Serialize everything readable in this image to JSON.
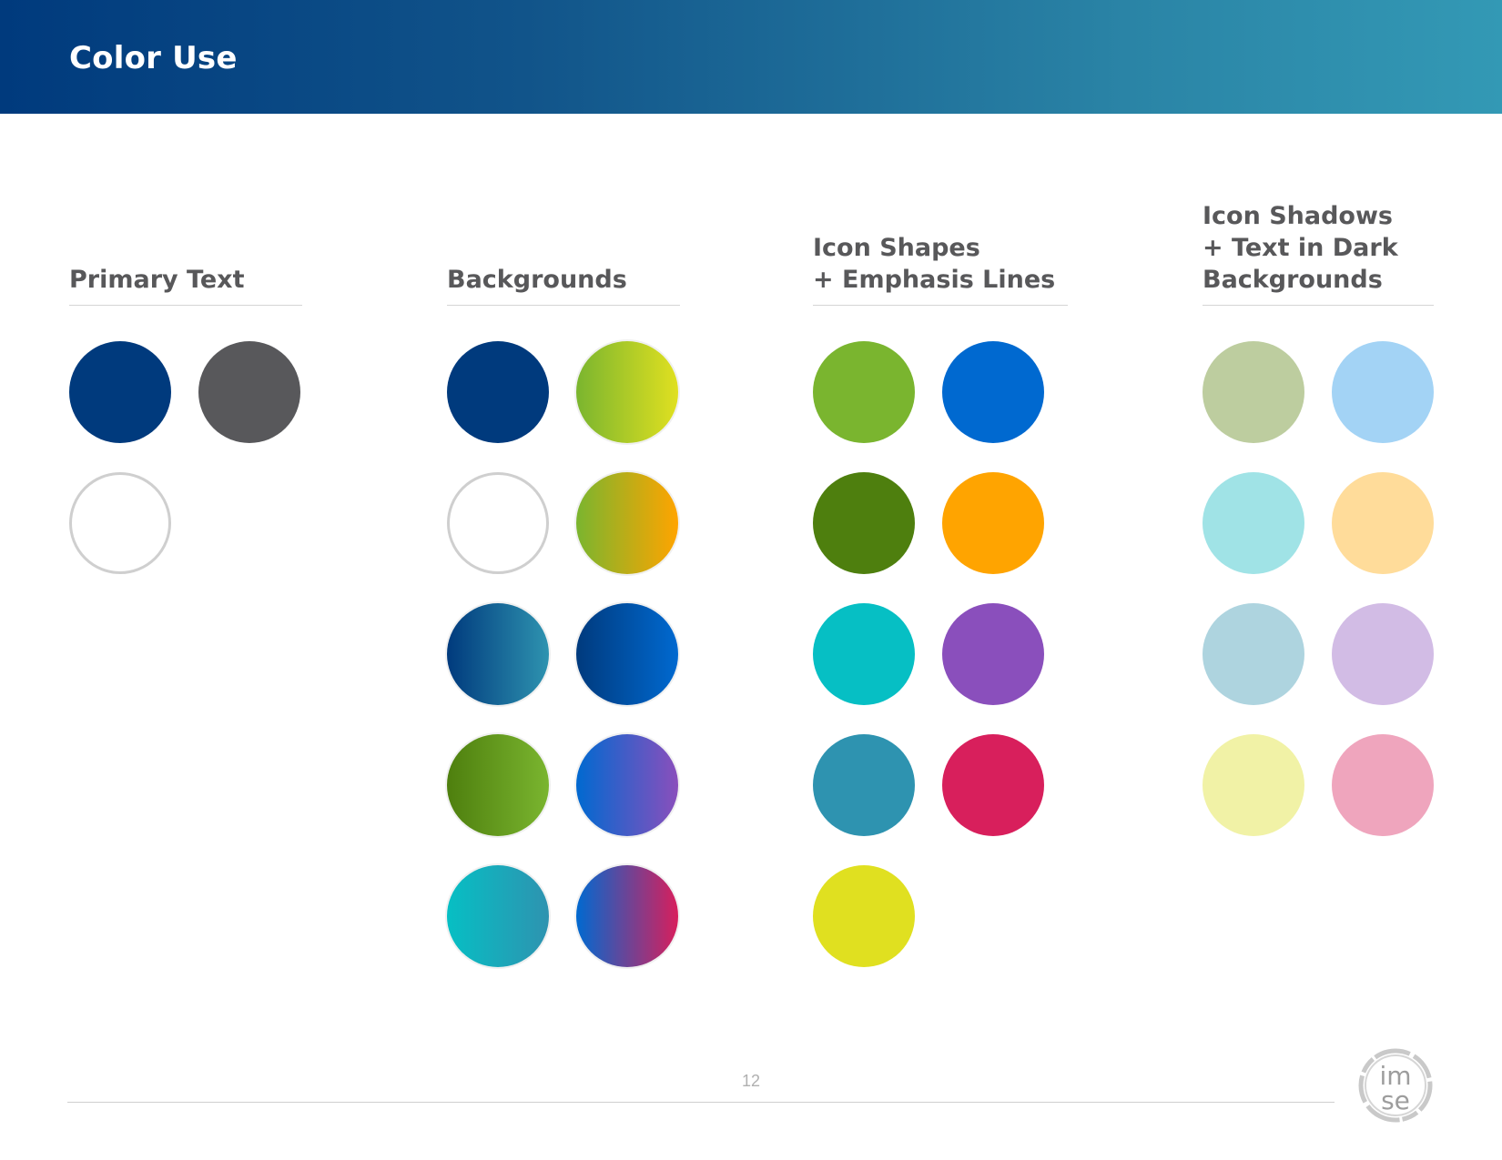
{
  "header": {
    "title": "Color Use"
  },
  "columns": [
    {
      "title": "Primary Text",
      "swatches": [
        {
          "color": "#003a7d",
          "style": "solid"
        },
        {
          "color": "#58585b",
          "style": "solid"
        },
        {
          "color": "#ffffff",
          "style": "outlined"
        }
      ]
    },
    {
      "title": "Backgrounds",
      "swatches": [
        {
          "color": "#003a7d",
          "style": "solid"
        },
        {
          "color": "linear-gradient(90deg, #7ab52f, #e0e020)",
          "style": "gradient"
        },
        {
          "color": "#ffffff",
          "style": "outlined"
        },
        {
          "color": "linear-gradient(90deg, #7ab52f, #ffa400)",
          "style": "gradient"
        },
        {
          "color": "linear-gradient(90deg, #003a7d, #2e93b0)",
          "style": "gradient"
        },
        {
          "color": "linear-gradient(90deg, #003a7d, #0069d0)",
          "style": "gradient"
        },
        {
          "color": "linear-gradient(90deg, #4e7f0e, #7ab52f)",
          "style": "gradient"
        },
        {
          "color": "linear-gradient(90deg, #0069d0, #8a4fbc)",
          "style": "gradient"
        },
        {
          "color": "linear-gradient(90deg, #06bfc4, #2e93b0)",
          "style": "gradient"
        },
        {
          "color": "linear-gradient(90deg, #0069d0, #d81f5c)",
          "style": "gradient"
        }
      ]
    },
    {
      "title": "Icon Shapes\n+ Emphasis Lines",
      "swatches": [
        {
          "color": "#7ab52f",
          "style": "solid"
        },
        {
          "color": "#0069d0",
          "style": "solid"
        },
        {
          "color": "#4e7f0e",
          "style": "solid"
        },
        {
          "color": "#ffa400",
          "style": "solid"
        },
        {
          "color": "#06bfc4",
          "style": "solid"
        },
        {
          "color": "#8a4fbc",
          "style": "solid"
        },
        {
          "color": "#2e93b0",
          "style": "solid"
        },
        {
          "color": "#d81f5c",
          "style": "solid"
        },
        {
          "color": "#e0e020",
          "style": "solid"
        }
      ]
    },
    {
      "title": "Icon Shadows\n+ Text in Dark\nBackgrounds",
      "swatches": [
        {
          "color": "#bdcd9f",
          "style": "solid"
        },
        {
          "color": "#a3d3f5",
          "style": "solid"
        },
        {
          "color": "#a0e3e6",
          "style": "solid"
        },
        {
          "color": "#ffdc9a",
          "style": "solid"
        },
        {
          "color": "#aed4df",
          "style": "solid"
        },
        {
          "color": "#d2bce5",
          "style": "solid"
        },
        {
          "color": "#f1f2a6",
          "style": "solid"
        },
        {
          "color": "#efa5bd",
          "style": "solid"
        }
      ]
    }
  ],
  "footer": {
    "page_number": "12",
    "logo_text_top": "im",
    "logo_text_bottom": "se"
  }
}
